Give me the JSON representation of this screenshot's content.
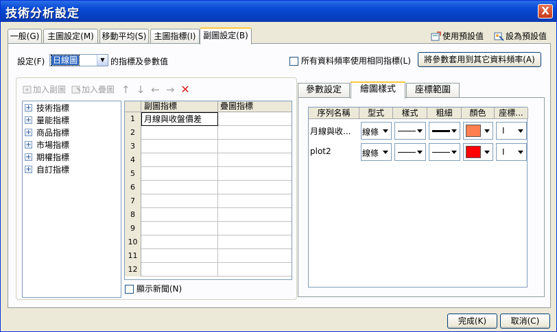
{
  "window": {
    "title": "技術分析設定",
    "close_label": "X"
  },
  "tabs": [
    {
      "label": "一般(G)"
    },
    {
      "label": "主圖設定(M)"
    },
    {
      "label": "移動平均(S)"
    },
    {
      "label": "主圖指標(I)"
    },
    {
      "label": "副圖設定(B)",
      "active": true
    }
  ],
  "top_links": {
    "use_default": "使用預設值",
    "set_default": "設為預設值"
  },
  "settings": {
    "label": "設定(F)",
    "selected": "日線圖",
    "suffix": "的指標及參數值",
    "same_indicator_label": "所有資料頻率使用相同指標(L)",
    "same_indicator_checked": false,
    "apply_button": "將參數套用到其它資料頻率(A)"
  },
  "toolbar": {
    "add_sub": "加入副圖",
    "add_overlay": "加入疊圖",
    "up": "↑",
    "down": "↓",
    "left": "←",
    "right": "→",
    "delete": "✕"
  },
  "tree": {
    "items": [
      "技術指標",
      "量能指標",
      "商品指標",
      "市場指標",
      "期權指標",
      "自訂指標"
    ]
  },
  "indicator_grid": {
    "headers": [
      "副圖指標",
      "疊圖指標"
    ],
    "rows": [
      {
        "n": "1",
        "sub": "月線與收盤價差",
        "overlay": ""
      },
      {
        "n": "2",
        "sub": "",
        "overlay": ""
      },
      {
        "n": "3",
        "sub": "",
        "overlay": ""
      },
      {
        "n": "4",
        "sub": "",
        "overlay": ""
      },
      {
        "n": "5",
        "sub": "",
        "overlay": ""
      },
      {
        "n": "6",
        "sub": "",
        "overlay": ""
      },
      {
        "n": "7",
        "sub": "",
        "overlay": ""
      },
      {
        "n": "8",
        "sub": "",
        "overlay": ""
      },
      {
        "n": "9",
        "sub": "",
        "overlay": ""
      },
      {
        "n": "10",
        "sub": "",
        "overlay": ""
      },
      {
        "n": "11",
        "sub": "",
        "overlay": ""
      },
      {
        "n": "12",
        "sub": "",
        "overlay": ""
      }
    ]
  },
  "show_news_label": "顯示新聞(N)",
  "show_news_checked": false,
  "param_tabs": [
    {
      "label": "參數設定"
    },
    {
      "label": "繪圖樣式",
      "active": true
    },
    {
      "label": "座標範圍"
    }
  ],
  "style_grid": {
    "headers": [
      "序列名稱",
      "型式",
      "樣式",
      "粗細",
      "顏色",
      "座標..."
    ],
    "rows": [
      {
        "name": "月線與收...",
        "type": "線條",
        "style": "solid",
        "weight": "thick",
        "color": "#ff7f50",
        "axis": "I"
      },
      {
        "name": "plot2",
        "type": "線條",
        "style": "solid",
        "weight": "thin",
        "color": "#ff0000",
        "axis": "I"
      }
    ]
  },
  "footer": {
    "ok": "完成(K)",
    "cancel": "取消(C)"
  }
}
